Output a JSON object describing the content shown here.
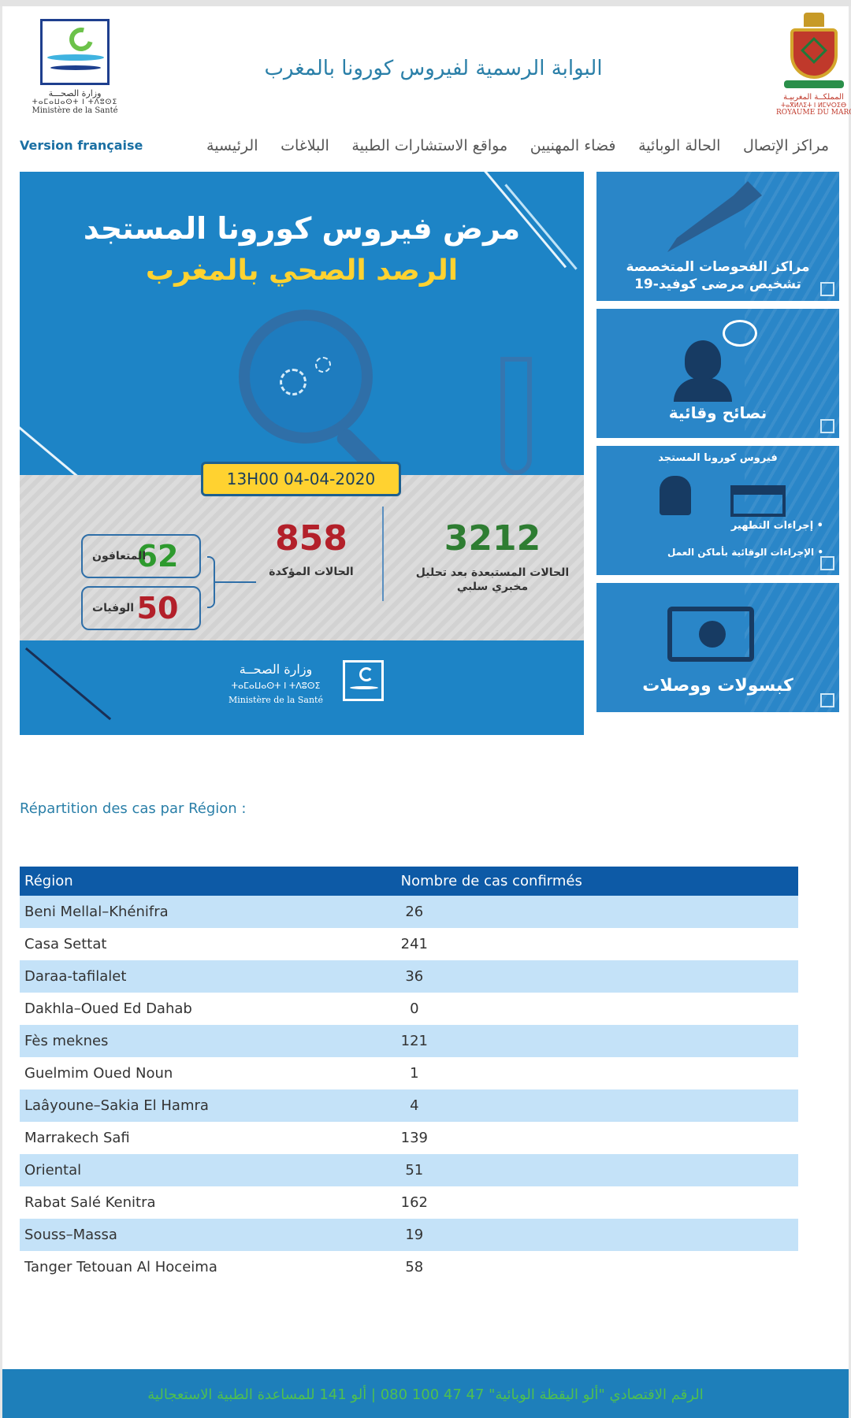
{
  "header": {
    "ministry_logo": {
      "ar": "وزارة الصحـــة",
      "tf": "ⵜⴰⵎⴰⵡⴰⵙⵜ ⵏ ⵜⴷⵓⵙⵉ",
      "fr": "Ministère de la Santé"
    },
    "title": "البوابة الرسمية لفيروس كورونا بالمغرب",
    "emblem": {
      "ar": "المملكــة المغربيـة",
      "tf": "ⵜⴰⴳⵍⴷⵉⵜ ⵏ ⵍⵎⵖⵔⵉⴱ",
      "fr": "ROYAUME DU MAROC"
    }
  },
  "nav": {
    "version_fr": "Version française",
    "items": [
      "الرئيسية",
      "البلاغات",
      "مواقع الاستشارات الطبية",
      "فضاء المهنيين",
      "الحالة الوبائية",
      "مراكز الإتصال"
    ]
  },
  "hero": {
    "title_line1": "مرض فيروس كورونا المستجد",
    "title_line2": "الرصد الصحي بالمغرب",
    "date": "13H00  04-04-2020",
    "recovered": {
      "value": "62",
      "label": "المتعافون"
    },
    "deaths": {
      "value": "50",
      "label": "الوفيات"
    },
    "confirmed": {
      "value": "858",
      "label": "الحالات المؤكدة"
    },
    "excluded": {
      "value": "3212",
      "label": "الحالات المستبعدة بعد تحليل مخبري سلبي"
    },
    "ministry": {
      "ar": "وزارة الصحــة",
      "tf": "ⵜⴰⵎⴰⵡⴰⵙⵜ ⵏ ⵜⴷⵓⵙⵉ",
      "fr": "Ministère de la Santé"
    }
  },
  "cards": {
    "testing_centers": "مراكز الفحوصات المتخصصة تشخيص مرضى كوفيد-19",
    "prevention_tips": "نصائح وقائية",
    "procedures": {
      "title": "فيروس كورونا المستجد",
      "item1": "• إجراءات التطهير",
      "item2": "• الإجراءات الوقائية بأماكن العمل"
    },
    "capsules": "كبسولات ووصلات"
  },
  "regions": {
    "title": "Répartition des cas par Région :",
    "headers": [
      "Région",
      "Nombre de cas confirmés"
    ],
    "rows": [
      [
        "Beni Mellal–Khénifra",
        "26"
      ],
      [
        "Casa Settat",
        "241"
      ],
      [
        "Daraa-tafilalet",
        "36"
      ],
      [
        "Dakhla–Oued Ed Dahab",
        "0"
      ],
      [
        "Fès meknes",
        "121"
      ],
      [
        "Guelmim Oued Noun",
        "1"
      ],
      [
        "Laâyoune–Sakia El Hamra",
        "4"
      ],
      [
        "Marrakech Safi",
        "139"
      ],
      [
        "Oriental",
        "51"
      ],
      [
        "Rabat Salé Kenitra",
        "162"
      ],
      [
        "Souss–Massa",
        "19"
      ],
      [
        "Tanger Tetouan Al Hoceima",
        "58"
      ]
    ]
  },
  "footer": {
    "text": "الرقم الاقتصادي \"ألو اليقظة الوبائية\" 47 47 100 080    |    ألو 141 للمساعدة الطبية الاستعجالية"
  },
  "colors": {
    "brand_blue": "#1d84c6",
    "table_header": "#0d5aa6",
    "table_stripe": "#c4e2f8",
    "accent_yellow": "#ffd230",
    "confirmed_red": "#b3202a",
    "recovered_green": "#2e9a2e"
  }
}
